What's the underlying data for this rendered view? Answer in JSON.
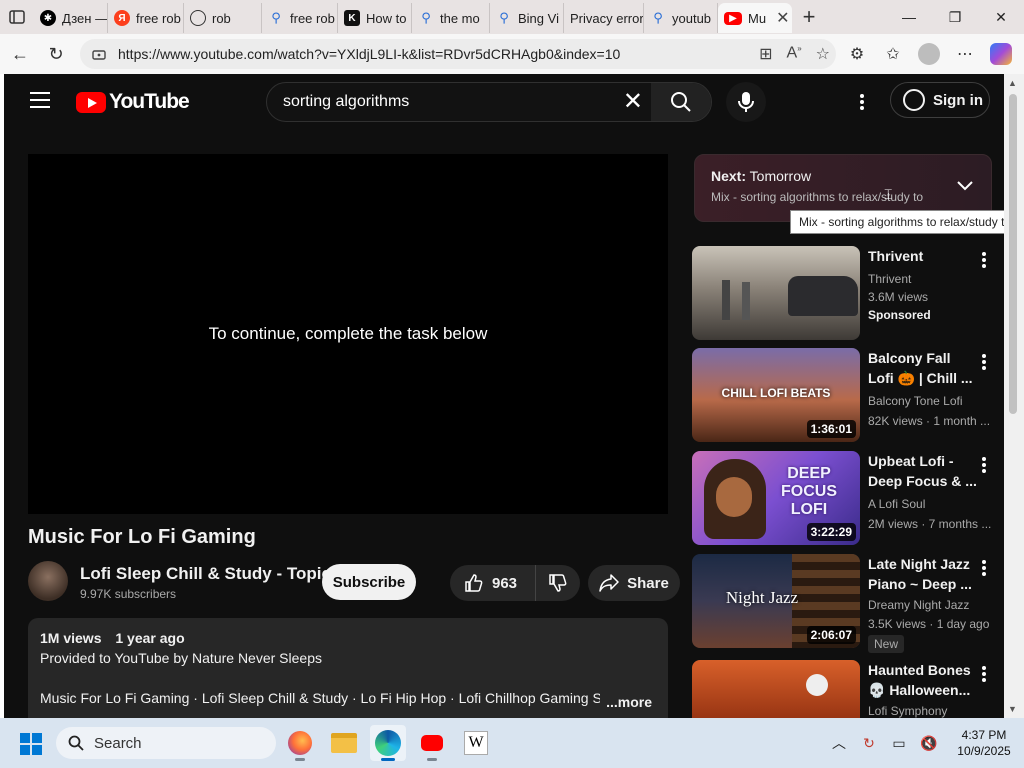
{
  "browser": {
    "tabs": [
      {
        "label": "Дзен —",
        "icon": "dzen-icon"
      },
      {
        "label": "free rob",
        "icon": "yandex-icon"
      },
      {
        "label": "rob",
        "icon": "globe-icon"
      },
      {
        "label": "free rob",
        "icon": "search-icon"
      },
      {
        "label": "How to",
        "icon": "k-icon"
      },
      {
        "label": "the mo",
        "icon": "search-icon"
      },
      {
        "label": "Bing Vi",
        "icon": "search-icon"
      },
      {
        "label": "Privacy error",
        "icon": "warning-icon"
      },
      {
        "label": "youtub",
        "icon": "search-icon"
      },
      {
        "label": "Mu",
        "icon": "youtube-icon",
        "active": true
      }
    ],
    "url": "https://www.youtube.com/watch?v=YXldjL9LI-k&list=RDvr5dCRHAgb0&index=10"
  },
  "youtube": {
    "logo_text": "YouTube",
    "search_query": "sorting algorithms",
    "sign_in_label": "Sign in",
    "player_message": "To continue, complete the task below",
    "video_title": "Music For Lo Fi Gaming",
    "channel": {
      "name": "Lofi Sleep Chill & Study - Topic",
      "subscribers": "9.97K subscribers"
    },
    "subscribe_label": "Subscribe",
    "like_count": "963",
    "share_label": "Share",
    "description": {
      "views": "1M views",
      "age": "1 year ago",
      "provided_by": "Provided to YouTube by Nature Never Sleeps",
      "tags": "Music For Lo Fi Gaming · Lofi Sleep Chill & Study · Lo Fi Hip Hop · Lofi Chillhop Gaming Stre",
      "more_label": "...more"
    },
    "next_card": {
      "label_prefix": "Next:",
      "label_title": "Tomorrow",
      "subtitle": "Mix - sorting algorithms to relax/study to"
    },
    "tooltip": "Mix - sorting algorithms to relax/study to",
    "recommendations": [
      {
        "title": "Thrivent",
        "line1": "Thrivent",
        "line2": "3.6M views",
        "extra": "Sponsored",
        "duration": "",
        "thumb_text": ""
      },
      {
        "title": "Balcony Fall\nLofi 🎃 | Chill ...",
        "line1": "Balcony Tone Lofi",
        "line2": "82K views · 1 month ...",
        "extra": "",
        "duration": "1:36:01",
        "thumb_text": "CHILL LOFI BEATS"
      },
      {
        "title": "Upbeat Lofi -\nDeep Focus & ...",
        "line1": "A Lofi Soul",
        "line2": "2M views · 7 months ...",
        "extra": "",
        "duration": "3:22:29",
        "thumb_text": "DEEP FOCUS LOFI"
      },
      {
        "title": "Late Night Jazz\nPiano ~ Deep ...",
        "line1": "Dreamy Night Jazz",
        "line2": "3.5K views · 1 day ago",
        "extra": "New",
        "duration": "2:06:07",
        "thumb_text": "Night Jazz"
      },
      {
        "title": "Haunted Bones\n💀 Halloween...",
        "line1": "Lofi Symphony",
        "line2": "",
        "extra": "",
        "duration": "",
        "thumb_text": ""
      }
    ]
  },
  "taskbar": {
    "search_label": "Search",
    "time": "4:37 PM",
    "date": "10/9/2025"
  }
}
